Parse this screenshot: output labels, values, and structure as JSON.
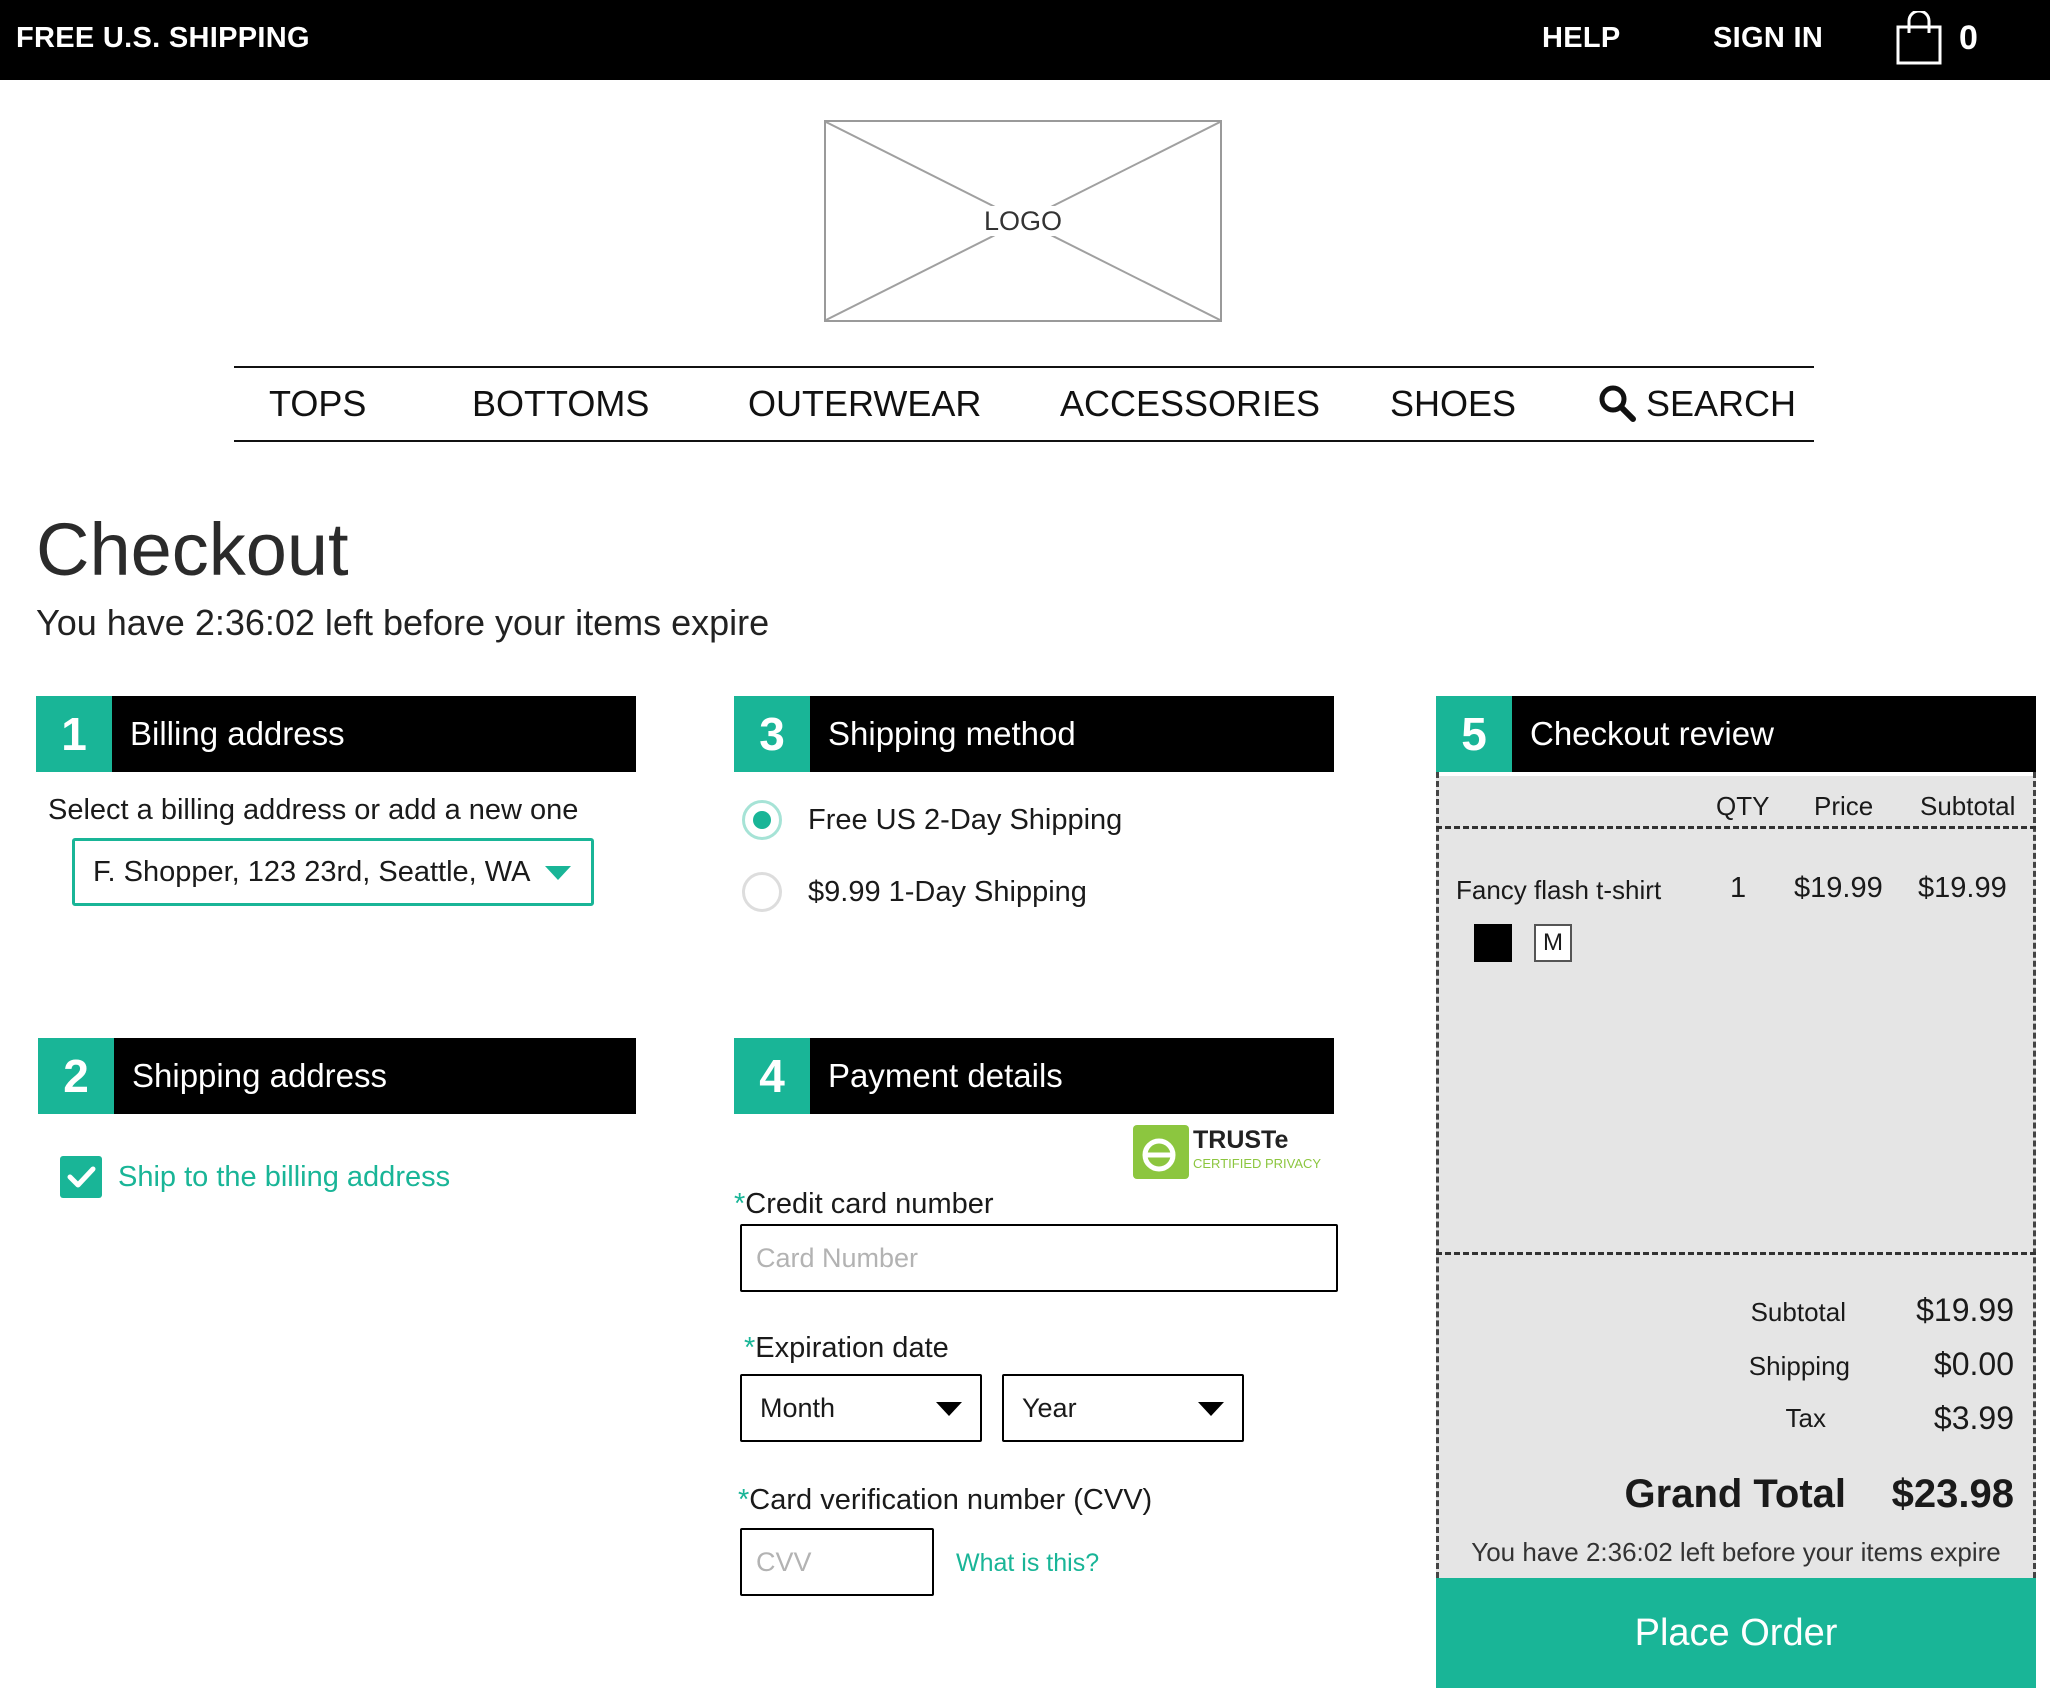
{
  "topbar": {
    "promo": "FREE U.S. SHIPPING",
    "help": "HELP",
    "sign_in": "SIGN IN",
    "cart_count": "0"
  },
  "logo": {
    "label": "LOGO"
  },
  "nav": {
    "items": [
      "TOPS",
      "BOTTOMS",
      "OUTERWEAR",
      "ACCESSORIES",
      "SHOES"
    ],
    "search": "SEARCH"
  },
  "page": {
    "title": "Checkout",
    "timer_text": "You have 2:36:02 left before your items expire"
  },
  "billing": {
    "number": "1",
    "title": "Billing address",
    "instruction": "Select a billing address or add a new one",
    "selected": "F. Shopper, 123 23rd, Seattle, WA"
  },
  "shipping_address": {
    "number": "2",
    "title": "Shipping address",
    "checkbox_label": "Ship to the billing address",
    "checked": true
  },
  "shipping_method": {
    "number": "3",
    "title": "Shipping method",
    "options": [
      {
        "label": "Free US 2-Day Shipping",
        "selected": true
      },
      {
        "label": "$9.99 1-Day Shipping",
        "selected": false
      }
    ]
  },
  "payment": {
    "number": "4",
    "title": "Payment details",
    "badge": {
      "name": "TRUSTe",
      "sub": "CERTIFIED PRIVACY"
    },
    "card_label": "Credit card number",
    "card_placeholder": "Card Number",
    "exp_label": "Expiration date",
    "month": "Month",
    "year": "Year",
    "cvv_label": "Card verification number (CVV)",
    "cvv_placeholder": "CVV",
    "cvv_help": "What is this?",
    "required_mark": "*"
  },
  "review": {
    "number": "5",
    "title": "Checkout review",
    "columns": [
      "QTY",
      "Price",
      "Subtotal"
    ],
    "items": [
      {
        "name": "Fancy flash t-shirt",
        "qty": "1",
        "price": "$19.99",
        "subtotal": "$19.99",
        "color": "#000000",
        "size": "M"
      }
    ],
    "totals": {
      "subtotal_label": "Subtotal",
      "subtotal": "$19.99",
      "shipping_label": "Shipping",
      "shipping": "$0.00",
      "tax_label": "Tax",
      "tax": "$3.99"
    },
    "grand_total_label": "Grand Total",
    "grand_total": "$23.98",
    "timer_text": "You have 2:36:02 left before your items expire",
    "place_order": "Place Order"
  },
  "colors": {
    "accent": "#19b597",
    "bar": "#000000",
    "panel": "#e5e5e5"
  }
}
